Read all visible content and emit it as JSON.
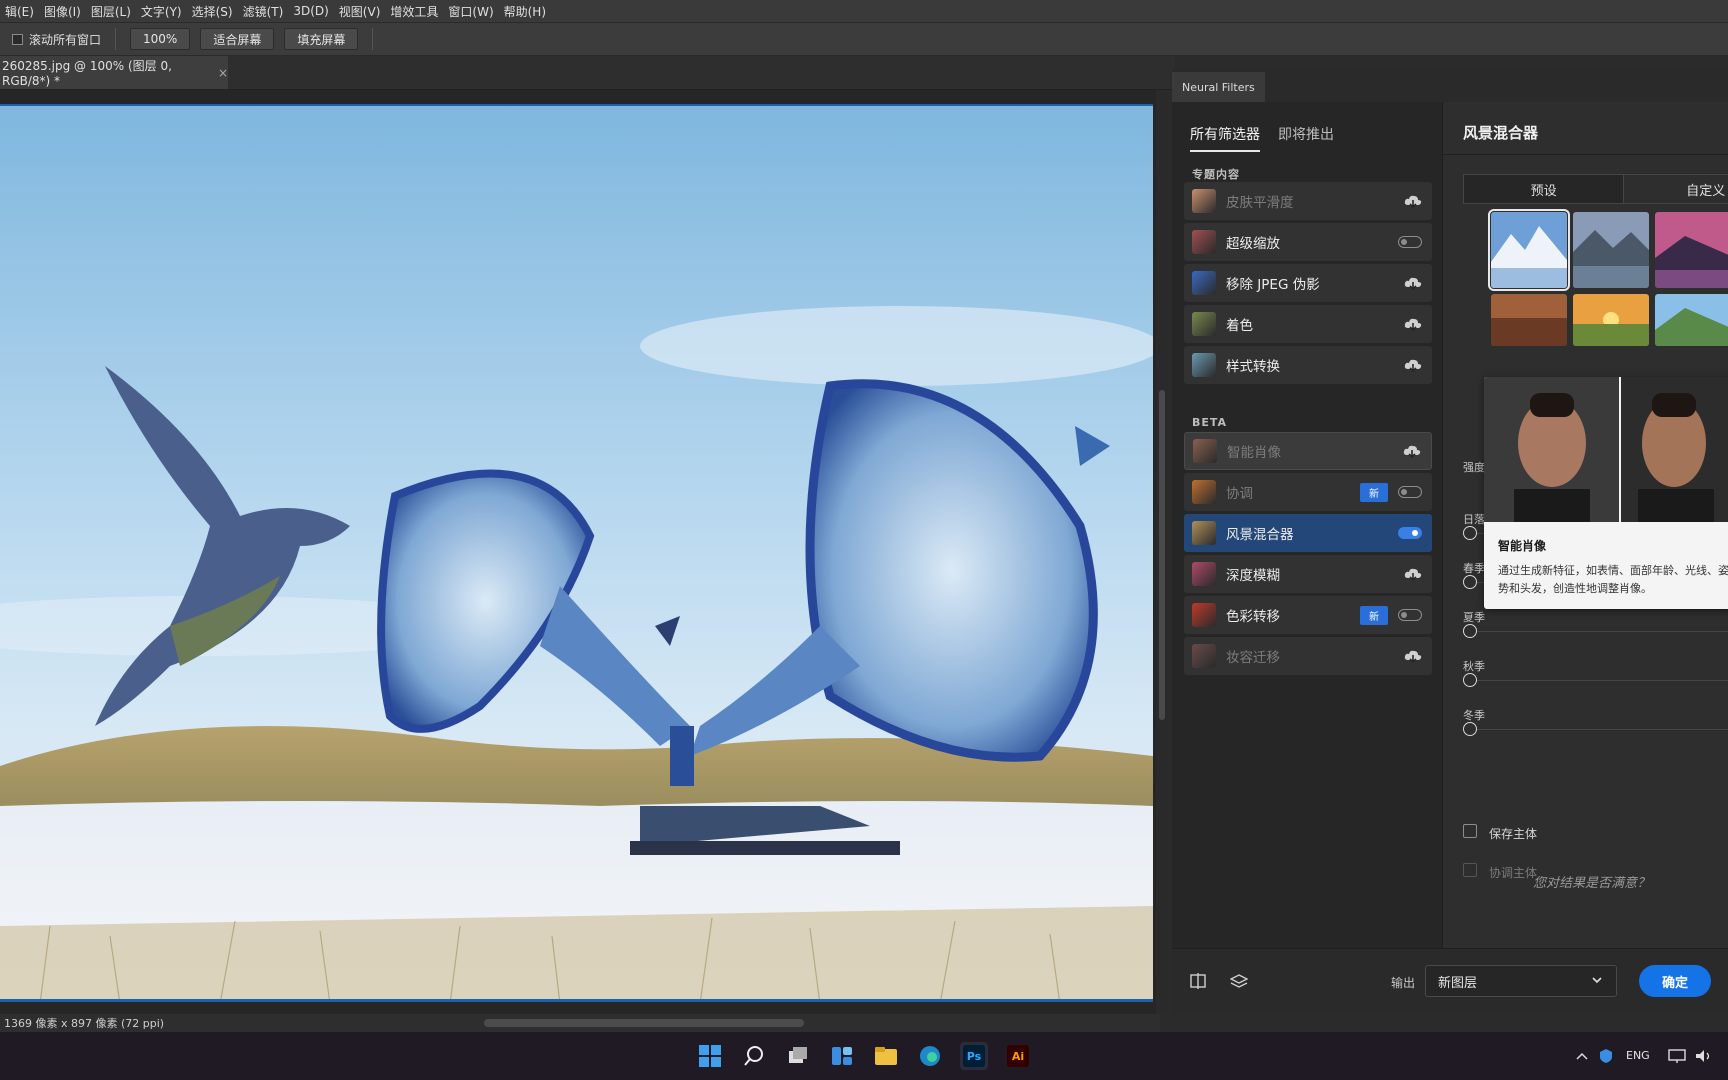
{
  "menu": [
    "辑(E)",
    "图像(I)",
    "图层(L)",
    "文字(Y)",
    "选择(S)",
    "滤镜(T)",
    "3D(D)",
    "视图(V)",
    "增效工具",
    "窗口(W)",
    "帮助(H)"
  ],
  "options": {
    "scroll_all_label": "滚动所有窗口",
    "zoom_value": "100%",
    "fit_screen": "适合屏幕",
    "fill_screen": "填充屏幕"
  },
  "document": {
    "tab_title": "260285.jpg @ 100% (图层 0, RGB/8*) *",
    "close_glyph": "×",
    "status": "1369 像素 x 897 像素 (72 ppi)"
  },
  "neural_filters": {
    "panel_title": "Neural Filters",
    "tabs": [
      "所有筛选器",
      "即将推出"
    ],
    "section_featured": "专题内容",
    "section_beta": "BETA",
    "featured": [
      {
        "label": "皮肤平滑度",
        "state": "cloud",
        "dim": true
      },
      {
        "label": "超级缩放",
        "state": "off",
        "dim": false
      },
      {
        "label": "移除 JPEG 伪影",
        "state": "cloud",
        "dim": false
      },
      {
        "label": "着色",
        "state": "cloud",
        "dim": false
      },
      {
        "label": "样式转换",
        "state": "cloud",
        "dim": false
      }
    ],
    "beta": [
      {
        "label": "智能肖像",
        "state": "cloud",
        "dim": true
      },
      {
        "label": "协调",
        "state": "off",
        "badge": "新",
        "dim": true
      },
      {
        "label": "风景混合器",
        "state": "on",
        "dim": false
      },
      {
        "label": "深度模糊",
        "state": "cloud",
        "dim": false
      },
      {
        "label": "色彩转移",
        "state": "off",
        "badge": "新",
        "dim": false
      },
      {
        "label": "妆容迁移",
        "state": "cloud",
        "dim": true
      }
    ],
    "detail": {
      "title": "风景混合器",
      "tab_preset": "预设",
      "tab_custom": "自定义",
      "strength_label": "强度",
      "sliders": [
        "日落",
        "春季",
        "夏季",
        "秋季",
        "冬季"
      ],
      "checkbox_preserve": "保存主体",
      "checkbox_harmonize": "协调主体",
      "feedback": "您对结果是否满意？"
    },
    "tooltip": {
      "title": "智能肖像",
      "desc": "通过生成新特征，如表情、面部年龄、光线、姿势和头发，创造性地调整肖像。"
    },
    "output_label": "输出",
    "output_value": "新图层",
    "ok": "确定"
  },
  "taskbar": {
    "ps": "Ps",
    "ai": "Ai",
    "lang": "ENG"
  },
  "colors": {
    "accent": "#1473e6",
    "selected_row": "#24477a"
  }
}
